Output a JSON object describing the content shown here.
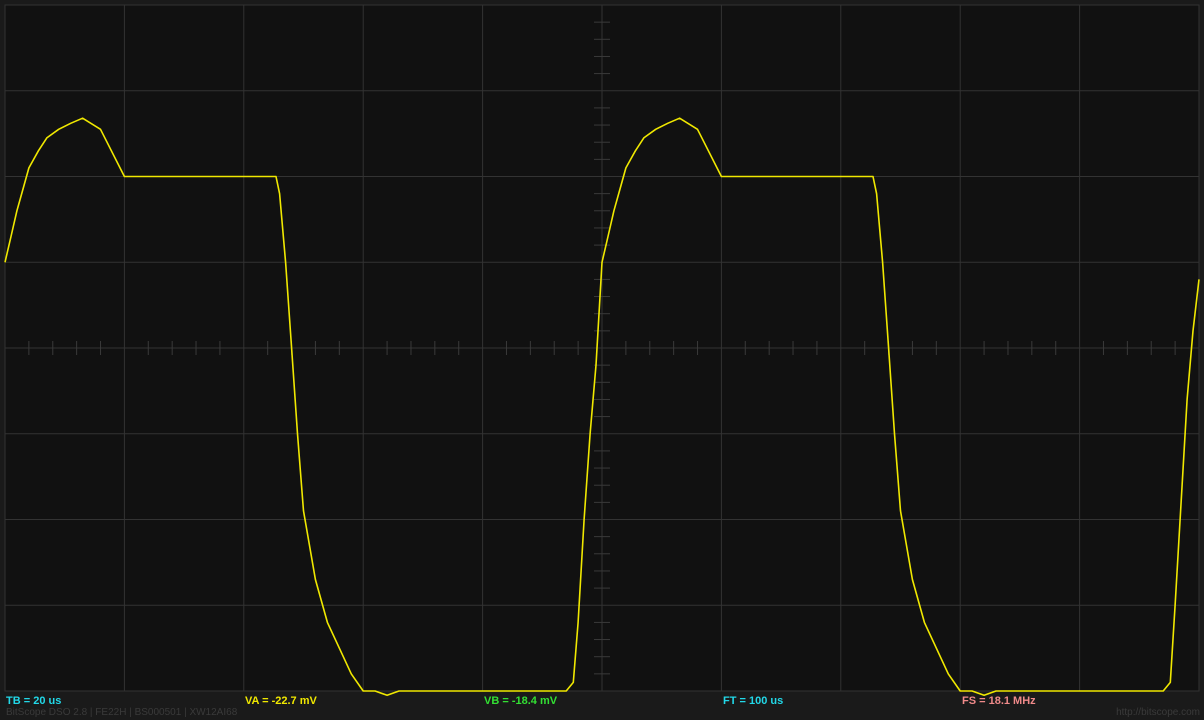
{
  "colors": {
    "background": "#1a1a1a",
    "screen": "#111111",
    "grid": "#333333",
    "trace": "#f0e800",
    "tb": "#22d8e8",
    "va": "#f0e800",
    "vb": "#33e033",
    "ft": "#22d8e8",
    "fs": "#f08a8a"
  },
  "readouts": {
    "tb": "TB = 20 us",
    "va": "VA = -22.7 mV",
    "vb": "VB = -18.4 mV",
    "ft": "FT = 100 us",
    "fs": "FS = 18.1 MHz"
  },
  "footer": {
    "left": "BitScope DSO 2.8 | FE22H | BS000501 | XW12AI68",
    "right": "http://bitscope.com"
  },
  "chart_data": {
    "type": "line",
    "grid": true,
    "divisions": {
      "x": 10,
      "y": 8
    },
    "xlim": [
      0,
      10
    ],
    "ylim": [
      -4,
      4
    ],
    "series": [
      {
        "color": "#f0e800",
        "x": [
          0,
          0.05,
          0.1,
          0.15,
          0.2,
          0.28,
          0.35,
          0.45,
          0.55,
          0.65,
          0.8,
          1.0,
          1.5,
          2.0,
          2.2,
          2.27,
          2.3,
          2.35,
          2.4,
          2.45,
          2.5,
          2.6,
          2.7,
          2.8,
          2.9,
          3.0,
          3.1,
          3.2,
          3.3,
          3.4,
          3.5,
          3.6,
          3.7,
          3.8,
          4.0,
          4.5,
          4.7,
          4.76,
          4.8,
          4.85,
          4.9,
          4.95,
          5.0,
          5.05,
          5.1,
          5.15,
          5.2,
          5.28,
          5.35,
          5.45,
          5.55,
          5.65,
          5.8,
          6.0,
          6.5,
          7.0,
          7.2,
          7.27,
          7.3,
          7.35,
          7.4,
          7.45,
          7.5,
          7.6,
          7.7,
          7.8,
          7.9,
          8.0,
          8.1,
          8.2,
          8.3,
          8.4,
          8.5,
          8.6,
          8.7,
          8.8,
          9.0,
          9.5,
          9.7,
          9.76,
          9.8,
          9.85,
          9.9,
          9.95,
          10.0
        ],
        "y": [
          1.0,
          1.3,
          1.6,
          1.85,
          2.1,
          2.3,
          2.45,
          2.55,
          2.62,
          2.68,
          2.55,
          2.0,
          2.0,
          2.0,
          2.0,
          2.0,
          1.8,
          1.0,
          0.0,
          -1.0,
          -1.9,
          -2.7,
          -3.2,
          -3.5,
          -3.8,
          -4.0,
          -4.0,
          -4.05,
          -4.0,
          -4.0,
          -4.0,
          -4.0,
          -4.0,
          -4.0,
          -4.0,
          -4.0,
          -4.0,
          -3.9,
          -3.2,
          -2.0,
          -1.0,
          -0.2,
          1.0,
          1.3,
          1.6,
          1.85,
          2.1,
          2.3,
          2.45,
          2.55,
          2.62,
          2.68,
          2.55,
          2.0,
          2.0,
          2.0,
          2.0,
          2.0,
          1.8,
          1.0,
          0.0,
          -1.0,
          -1.9,
          -2.7,
          -3.2,
          -3.5,
          -3.8,
          -4.0,
          -4.0,
          -4.05,
          -4.0,
          -4.0,
          -4.0,
          -4.0,
          -4.0,
          -4.0,
          -4.0,
          -4.0,
          -4.0,
          -3.9,
          -3.0,
          -1.8,
          -0.6,
          0.2,
          0.8
        ]
      }
    ]
  }
}
